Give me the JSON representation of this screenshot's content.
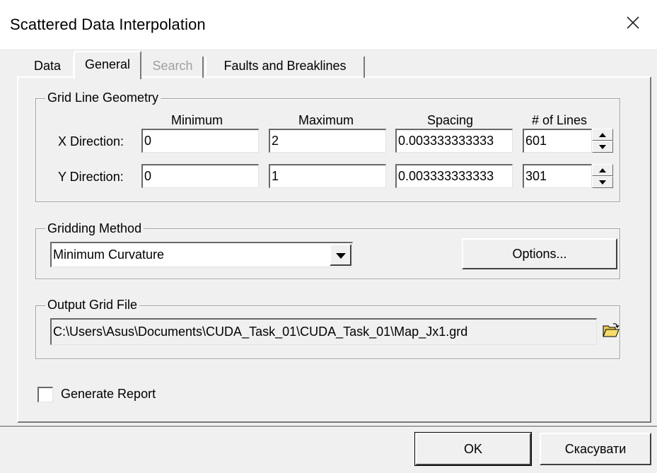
{
  "window": {
    "title": "Scattered Data Interpolation"
  },
  "tabs": [
    {
      "label": "Data",
      "state": "normal"
    },
    {
      "label": "General",
      "state": "active"
    },
    {
      "label": "Search",
      "state": "disabled"
    },
    {
      "label": "Faults and Breaklines",
      "state": "normal"
    }
  ],
  "grid_geometry": {
    "group_label": "Grid Line Geometry",
    "headers": {
      "minimum": "Minimum",
      "maximum": "Maximum",
      "spacing": "Spacing",
      "lines": "# of Lines"
    },
    "x": {
      "label": "X Direction:",
      "minimum": "0",
      "maximum": "2",
      "spacing": "0.003333333333",
      "lines": "601"
    },
    "y": {
      "label": "Y Direction:",
      "minimum": "0",
      "maximum": "1",
      "spacing": "0.003333333333",
      "lines": "301"
    }
  },
  "gridding_method": {
    "group_label": "Gridding Method",
    "selected": "Minimum Curvature",
    "options_button": "Options..."
  },
  "output_grid": {
    "group_label": "Output Grid File",
    "path": "C:\\Users\\Asus\\Documents\\CUDA_Task_01\\CUDA_Task_01\\Map_Jx1.grd",
    "browse_icon": "folder-open-icon"
  },
  "generate_report": {
    "label": "Generate Report",
    "checked": false
  },
  "buttons": {
    "ok": "OK",
    "cancel": "Скасувати"
  },
  "colors": {
    "face": "#f0f0f0",
    "titlebar": "#ffffff",
    "disabled_text": "#a0a0a0"
  }
}
